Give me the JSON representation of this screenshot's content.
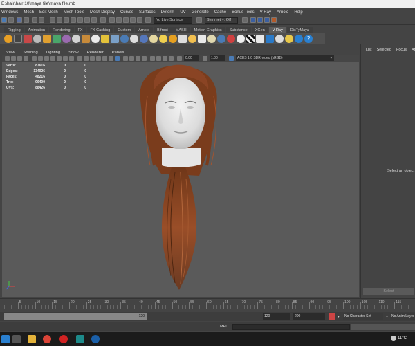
{
  "window": {
    "title": "E:\\hair\\hair 10\\maya file\\maya file.mb"
  },
  "menubar": {
    "items": [
      "Windows",
      "Mesh",
      "Edit Mesh",
      "Mesh Tools",
      "Mesh Display",
      "Curves",
      "Surfaces",
      "Deform",
      "UV",
      "Generate",
      "Cache",
      "Bonus Tools",
      "V-Ray",
      "Arnold",
      "Help"
    ]
  },
  "statusline": {
    "live_surface": "No Live Surface",
    "symmetry": "Symmetry: Off"
  },
  "shelf": {
    "tabs": [
      "Rigging",
      "Animation",
      "Rendering",
      "FX",
      "FX Caching",
      "Custom",
      "Arnold",
      "Bifrost",
      "MASH",
      "Motion Graphics",
      "Substance",
      "XGen",
      "V-Ray",
      "DisTyMaya"
    ],
    "active_tab": "V-Ray"
  },
  "panel": {
    "menus": [
      "View",
      "Shading",
      "Lighting",
      "Show",
      "Renderer",
      "Panels"
    ],
    "exposure": "0.00",
    "gamma": "1.00",
    "color_space": "ACES 1.0 SDR-video (sRGB)"
  },
  "hud": {
    "rows": [
      {
        "label": "Verts:",
        "v1": "87616",
        "v2": "0",
        "v3": "0"
      },
      {
        "label": "Edges:",
        "v1": "134926",
        "v2": "0",
        "v3": "0"
      },
      {
        "label": "Faces:",
        "v1": "48216",
        "v2": "0",
        "v3": "0"
      },
      {
        "label": "Tris:",
        "v1": "96400",
        "v2": "0",
        "v3": "0"
      },
      {
        "label": "UVs:",
        "v1": "88426",
        "v2": "0",
        "v3": "0"
      }
    ]
  },
  "attribute_editor": {
    "tabs": [
      "List",
      "Selected",
      "Focus",
      "Attr"
    ],
    "message": "Select an object",
    "select_button": "Select"
  },
  "timeslider": {
    "labels": [
      "5",
      "10",
      "15",
      "20",
      "25",
      "30",
      "35",
      "40",
      "45",
      "50",
      "55",
      "60",
      "65",
      "70",
      "75",
      "80",
      "85",
      "90",
      "95",
      "100",
      "105",
      "110",
      "115"
    ]
  },
  "rangeslider": {
    "range_end_label": "120",
    "end_time": "120",
    "anim_end": "200",
    "character_set": "No Character Set",
    "anim_layer": "No Anim Layer"
  },
  "commandline": {
    "label": "MEL"
  },
  "taskbar": {
    "weather": "11°C"
  },
  "colors": {
    "viewport_bg": "#5a5a5a",
    "hair": "#8a4424",
    "skin": "#e8e8e8",
    "active_tab": "#5d5d5d"
  }
}
